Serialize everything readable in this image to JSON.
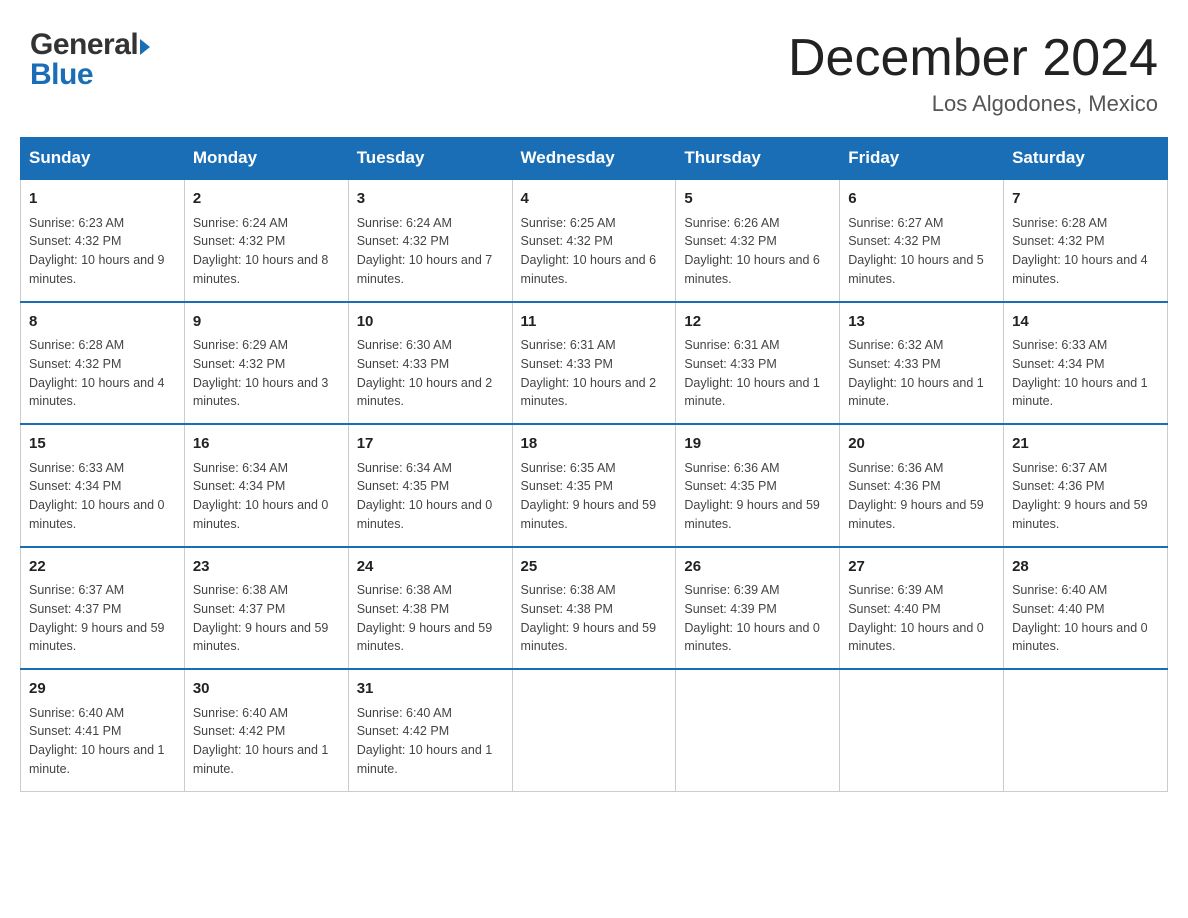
{
  "header": {
    "month_year": "December 2024",
    "location": "Los Algodones, Mexico",
    "logo_line1": "General",
    "logo_line2": "Blue"
  },
  "days_of_week": [
    "Sunday",
    "Monday",
    "Tuesday",
    "Wednesday",
    "Thursday",
    "Friday",
    "Saturday"
  ],
  "weeks": [
    [
      {
        "day": "1",
        "sunrise": "6:23 AM",
        "sunset": "4:32 PM",
        "daylight": "10 hours and 9 minutes."
      },
      {
        "day": "2",
        "sunrise": "6:24 AM",
        "sunset": "4:32 PM",
        "daylight": "10 hours and 8 minutes."
      },
      {
        "day": "3",
        "sunrise": "6:24 AM",
        "sunset": "4:32 PM",
        "daylight": "10 hours and 7 minutes."
      },
      {
        "day": "4",
        "sunrise": "6:25 AM",
        "sunset": "4:32 PM",
        "daylight": "10 hours and 6 minutes."
      },
      {
        "day": "5",
        "sunrise": "6:26 AM",
        "sunset": "4:32 PM",
        "daylight": "10 hours and 6 minutes."
      },
      {
        "day": "6",
        "sunrise": "6:27 AM",
        "sunset": "4:32 PM",
        "daylight": "10 hours and 5 minutes."
      },
      {
        "day": "7",
        "sunrise": "6:28 AM",
        "sunset": "4:32 PM",
        "daylight": "10 hours and 4 minutes."
      }
    ],
    [
      {
        "day": "8",
        "sunrise": "6:28 AM",
        "sunset": "4:32 PM",
        "daylight": "10 hours and 4 minutes."
      },
      {
        "day": "9",
        "sunrise": "6:29 AM",
        "sunset": "4:32 PM",
        "daylight": "10 hours and 3 minutes."
      },
      {
        "day": "10",
        "sunrise": "6:30 AM",
        "sunset": "4:33 PM",
        "daylight": "10 hours and 2 minutes."
      },
      {
        "day": "11",
        "sunrise": "6:31 AM",
        "sunset": "4:33 PM",
        "daylight": "10 hours and 2 minutes."
      },
      {
        "day": "12",
        "sunrise": "6:31 AM",
        "sunset": "4:33 PM",
        "daylight": "10 hours and 1 minute."
      },
      {
        "day": "13",
        "sunrise": "6:32 AM",
        "sunset": "4:33 PM",
        "daylight": "10 hours and 1 minute."
      },
      {
        "day": "14",
        "sunrise": "6:33 AM",
        "sunset": "4:34 PM",
        "daylight": "10 hours and 1 minute."
      }
    ],
    [
      {
        "day": "15",
        "sunrise": "6:33 AM",
        "sunset": "4:34 PM",
        "daylight": "10 hours and 0 minutes."
      },
      {
        "day": "16",
        "sunrise": "6:34 AM",
        "sunset": "4:34 PM",
        "daylight": "10 hours and 0 minutes."
      },
      {
        "day": "17",
        "sunrise": "6:34 AM",
        "sunset": "4:35 PM",
        "daylight": "10 hours and 0 minutes."
      },
      {
        "day": "18",
        "sunrise": "6:35 AM",
        "sunset": "4:35 PM",
        "daylight": "9 hours and 59 minutes."
      },
      {
        "day": "19",
        "sunrise": "6:36 AM",
        "sunset": "4:35 PM",
        "daylight": "9 hours and 59 minutes."
      },
      {
        "day": "20",
        "sunrise": "6:36 AM",
        "sunset": "4:36 PM",
        "daylight": "9 hours and 59 minutes."
      },
      {
        "day": "21",
        "sunrise": "6:37 AM",
        "sunset": "4:36 PM",
        "daylight": "9 hours and 59 minutes."
      }
    ],
    [
      {
        "day": "22",
        "sunrise": "6:37 AM",
        "sunset": "4:37 PM",
        "daylight": "9 hours and 59 minutes."
      },
      {
        "day": "23",
        "sunrise": "6:38 AM",
        "sunset": "4:37 PM",
        "daylight": "9 hours and 59 minutes."
      },
      {
        "day": "24",
        "sunrise": "6:38 AM",
        "sunset": "4:38 PM",
        "daylight": "9 hours and 59 minutes."
      },
      {
        "day": "25",
        "sunrise": "6:38 AM",
        "sunset": "4:38 PM",
        "daylight": "9 hours and 59 minutes."
      },
      {
        "day": "26",
        "sunrise": "6:39 AM",
        "sunset": "4:39 PM",
        "daylight": "10 hours and 0 minutes."
      },
      {
        "day": "27",
        "sunrise": "6:39 AM",
        "sunset": "4:40 PM",
        "daylight": "10 hours and 0 minutes."
      },
      {
        "day": "28",
        "sunrise": "6:40 AM",
        "sunset": "4:40 PM",
        "daylight": "10 hours and 0 minutes."
      }
    ],
    [
      {
        "day": "29",
        "sunrise": "6:40 AM",
        "sunset": "4:41 PM",
        "daylight": "10 hours and 1 minute."
      },
      {
        "day": "30",
        "sunrise": "6:40 AM",
        "sunset": "4:42 PM",
        "daylight": "10 hours and 1 minute."
      },
      {
        "day": "31",
        "sunrise": "6:40 AM",
        "sunset": "4:42 PM",
        "daylight": "10 hours and 1 minute."
      },
      null,
      null,
      null,
      null
    ]
  ],
  "labels": {
    "sunrise_prefix": "Sunrise: ",
    "sunset_prefix": "Sunset: ",
    "daylight_prefix": "Daylight: "
  }
}
